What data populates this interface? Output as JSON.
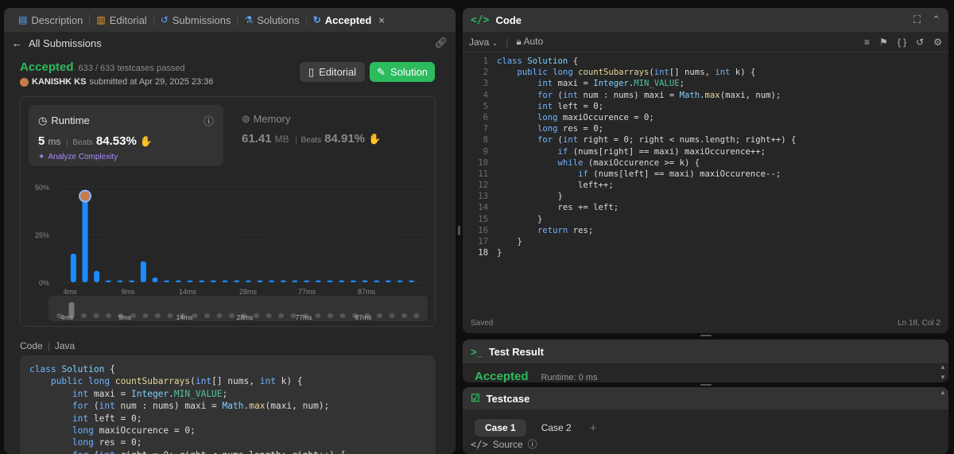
{
  "left": {
    "tabs": [
      {
        "label": "Description",
        "icon": "document-icon"
      },
      {
        "label": "Editorial",
        "icon": "book-icon"
      },
      {
        "label": "Submissions",
        "icon": "history-icon"
      },
      {
        "label": "Solutions",
        "icon": "flask-icon"
      },
      {
        "label": "Accepted",
        "icon": "accepted-icon",
        "close": "×"
      }
    ],
    "back_label": "All Submissions",
    "status": "Accepted",
    "testcases": "633 / 633 testcases passed",
    "user": "KANISHK KS",
    "submitted": "submitted at Apr 29, 2025 23:36",
    "editorial_btn": "Editorial",
    "solution_btn": "Solution",
    "runtime": {
      "title": "Runtime",
      "value": "5",
      "unit": "ms",
      "beats_label": "Beats",
      "beats": "84.53%",
      "analyze": "Analyze Complexity"
    },
    "memory": {
      "title": "Memory",
      "value": "61.41",
      "unit": "MB",
      "beats_label": "Beats",
      "beats": "84.91%"
    },
    "code_label": "Code",
    "code_lang": "Java"
  },
  "chart_data": {
    "type": "bar",
    "ylabels": [
      "50%",
      "25%",
      "0%"
    ],
    "xlabels": [
      "4ms",
      "9ms",
      "14ms",
      "28ms",
      "77ms",
      "87ms"
    ],
    "values": [
      15,
      46,
      6,
      1,
      1,
      1,
      11,
      2.5,
      1,
      1,
      1,
      1,
      1,
      1,
      1,
      1,
      1,
      1,
      1,
      1,
      1,
      1,
      1,
      1,
      1,
      1,
      1,
      1,
      1,
      1
    ],
    "highlight_index": 1,
    "ylim": [
      0,
      50
    ]
  },
  "code": {
    "title": "Code",
    "language": "Java",
    "mode": "Auto",
    "saved": "Saved",
    "cursor": "Ln 18, Col 2",
    "lines": [
      "class Solution {",
      "    public long countSubarrays(int[] nums, int k) {",
      "        int maxi = Integer.MIN_VALUE;",
      "        for (int num : nums) maxi = Math.max(maxi, num);",
      "        int left = 0;",
      "        long maxiOccurence = 0;",
      "        long res = 0;",
      "        for (int right = 0; right < nums.length; right++) {",
      "            if (nums[right] == maxi) maxiOccurence++;",
      "            while (maxiOccurence >= k) {",
      "                if (nums[left] == maxi) maxiOccurence--;",
      "                left++;",
      "            }",
      "            res += left;",
      "        }",
      "        return res;",
      "    }",
      "}"
    ]
  },
  "test_result": {
    "title": "Test Result",
    "status": "Accepted",
    "runtime": "Runtime: 0 ms"
  },
  "testcase": {
    "title": "Testcase",
    "cases": [
      "Case 1",
      "Case 2"
    ],
    "add": "+",
    "source": "Source"
  }
}
